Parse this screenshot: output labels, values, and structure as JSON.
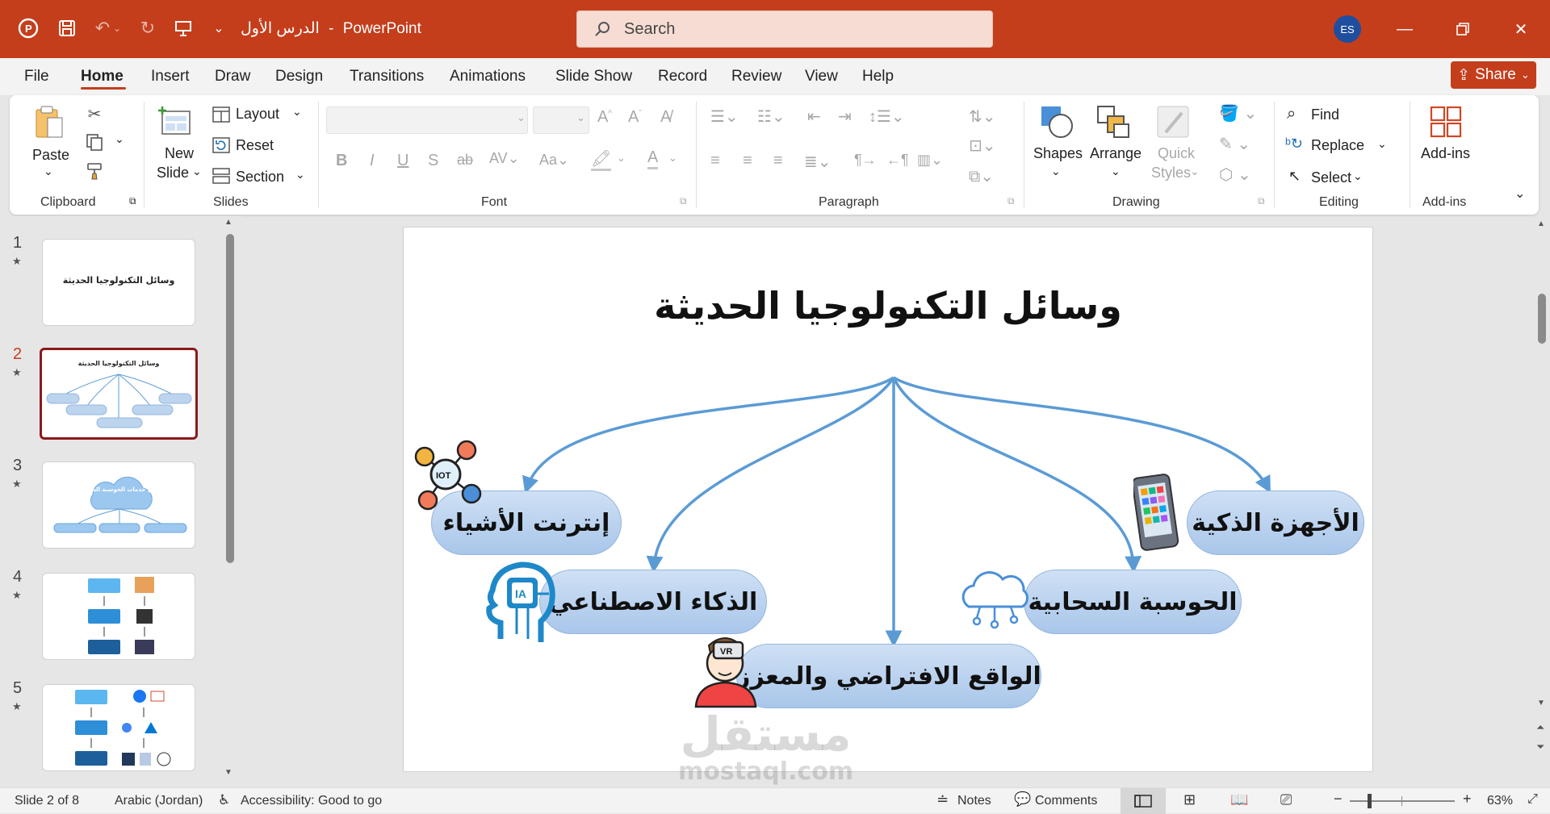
{
  "app": {
    "doc_title": "الدرس الأول",
    "title_sep": "-",
    "app_name": "PowerPoint",
    "search_placeholder": "Search",
    "avatar_initials": "ES",
    "brand_color": "#c43e1c"
  },
  "menu": {
    "tabs": [
      "File",
      "Home",
      "Insert",
      "Draw",
      "Design",
      "Transitions",
      "Animations",
      "Slide Show",
      "Record",
      "Review",
      "View",
      "Help"
    ],
    "active": "Home",
    "share_label": "Share"
  },
  "ribbon": {
    "clipboard": {
      "paste": "Paste",
      "label": "Clipboard"
    },
    "slides": {
      "new_slide_line1": "New",
      "new_slide_line2": "Slide",
      "layout": "Layout",
      "reset": "Reset",
      "section": "Section",
      "label": "Slides"
    },
    "font": {
      "label": "Font"
    },
    "paragraph": {
      "label": "Paragraph"
    },
    "drawing": {
      "shapes": "Shapes",
      "arrange": "Arrange",
      "quick1": "Quick",
      "quick2": "Styles",
      "label": "Drawing"
    },
    "editing": {
      "find": "Find",
      "replace": "Replace",
      "select": "Select",
      "label": "Editing"
    },
    "addins": {
      "button": "Add-ins",
      "label": "Add-ins"
    }
  },
  "thumbnails": [
    {
      "num": "1",
      "title": "وسائل التكنولوجيا الحديثة"
    },
    {
      "num": "2",
      "title": "وسائل التكنولوجيا الحديثة",
      "selected": true
    },
    {
      "num": "3",
      "title": "أنواع خدمات الحوسبة السحابية"
    },
    {
      "num": "4"
    },
    {
      "num": "5"
    }
  ],
  "slide": {
    "title": "وسائل التكنولوجيا الحديثة",
    "nodes": {
      "iot": "إنترنت الأشياء",
      "smart": "الأجهزة الذكية",
      "ai": "الذكاء الاصطناعي",
      "cloud": "الحوسبة السحابية",
      "vr": "الواقع الافتراضي والمعزز"
    },
    "icon_text": {
      "iot": "IOT",
      "ai": "IA",
      "vr": "VR"
    },
    "arrow_color": "#5b9bd5"
  },
  "status": {
    "slide_info": "Slide 2 of 8",
    "language": "Arabic (Jordan)",
    "accessibility": "Accessibility: Good to go",
    "notes": "Notes",
    "comments": "Comments",
    "zoom": "63%"
  },
  "watermark": {
    "arabic": "مستقل",
    "latin": "mostaql.com"
  }
}
